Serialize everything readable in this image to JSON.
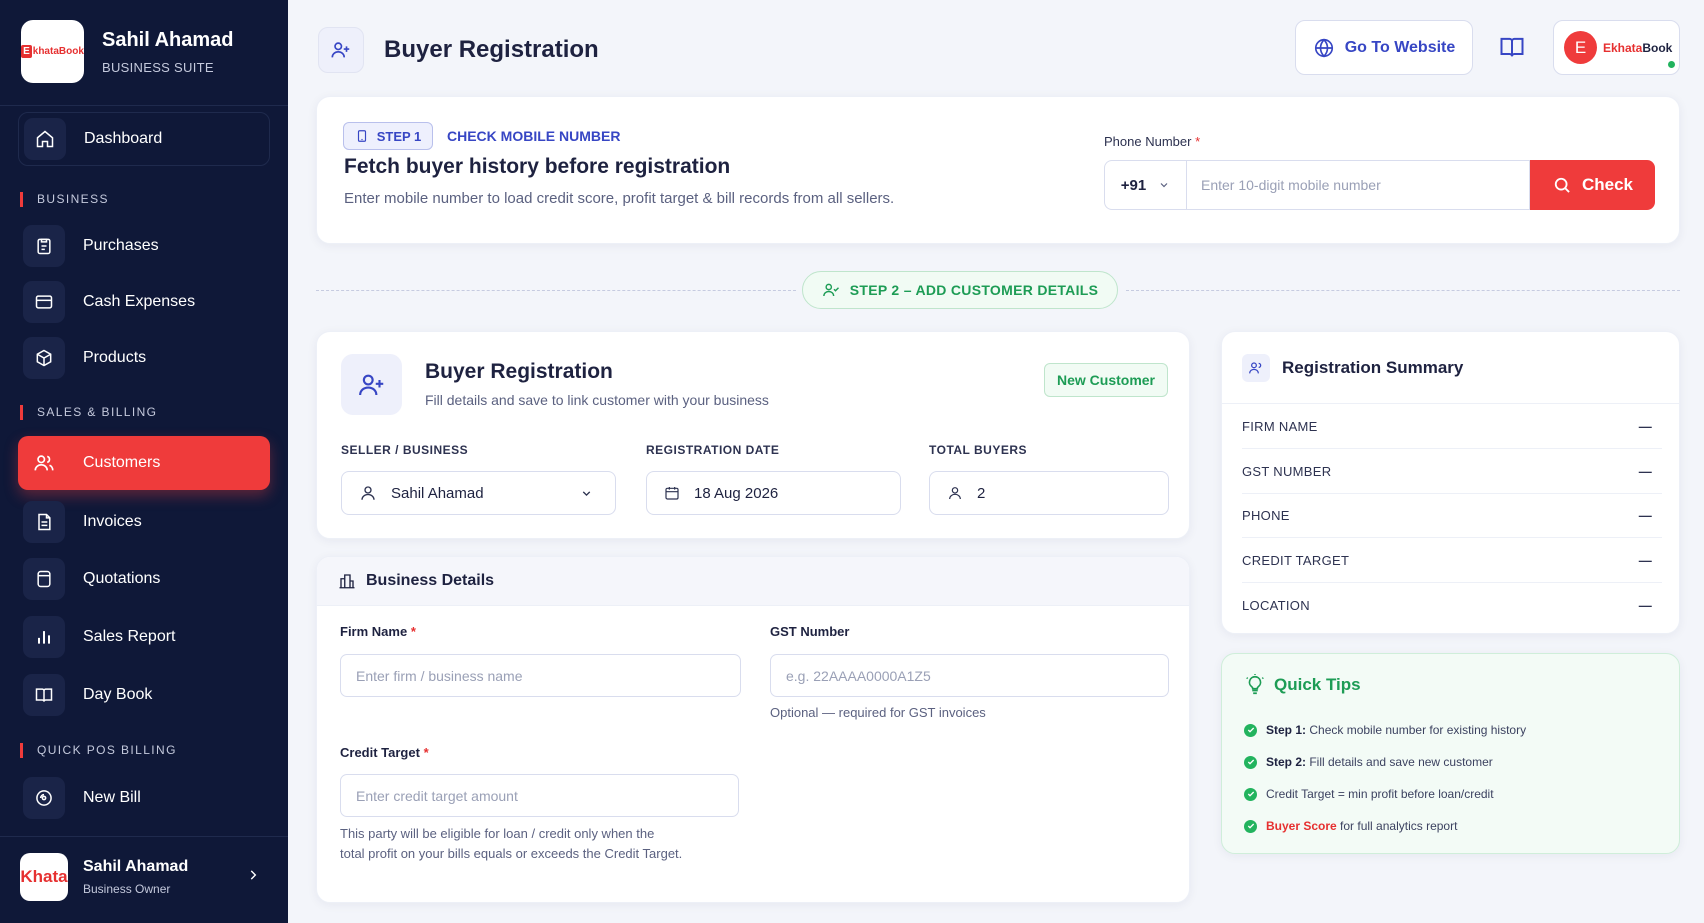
{
  "sidebar": {
    "brand_name": "Sahil Ahamad",
    "brand_sub": "BUSINESS SUITE",
    "logo_e": "E",
    "logo_text": "khataBook",
    "dashboard": "Dashboard",
    "section_business": "BUSINESS",
    "purchases": "Purchases",
    "cash_expenses": "Cash Expenses",
    "products": "Products",
    "section_sales": "SALES & BILLING",
    "customers": "Customers",
    "invoices": "Invoices",
    "quotations": "Quotations",
    "sales_report": "Sales Report",
    "day_book": "Day Book",
    "section_pos": "QUICK POS BILLING",
    "new_bill": "New Bill",
    "user_avatar_text": "Khata",
    "user_name": "Sahil Ahamad",
    "user_role": "Business Owner"
  },
  "header": {
    "title": "Buyer Registration",
    "website_button": "Go To Website",
    "account_initial": "E",
    "account_brand_a": "Ekhata",
    "account_brand_b": "Book"
  },
  "step1": {
    "badge": "STEP 1",
    "title": "CHECK MOBILE NUMBER",
    "heading": "Fetch buyer history before registration",
    "description": "Enter mobile number to load credit score, profit target & bill records from all sellers.",
    "phone_label": "Phone Number",
    "required_mark": "*",
    "country_code": "+91",
    "phone_placeholder": "Enter 10-digit mobile number",
    "check_button": "Check"
  },
  "step2": {
    "label": "STEP 2 – ADD CUSTOMER DETAILS"
  },
  "registration": {
    "title": "Buyer Registration",
    "subtitle": "Fill details and save to link customer with your business",
    "badge": "New Customer",
    "seller_label": "SELLER / BUSINESS",
    "seller_value": "Sahil Ahamad",
    "date_label": "REGISTRATION DATE",
    "date_value": "18 Aug 2026",
    "buyers_label": "TOTAL BUYERS",
    "buyers_value": "2"
  },
  "business": {
    "heading": "Business Details",
    "firm_label": "Firm Name",
    "firm_placeholder": "Enter firm / business name",
    "gst_label": "GST Number",
    "gst_placeholder": "e.g. 22AAAA0000A1Z5",
    "gst_hint": "Optional — required for GST invoices",
    "credit_label": "Credit Target",
    "credit_placeholder": "Enter credit target amount",
    "credit_hint_line1": "This party will be eligible for loan / credit only when the",
    "credit_hint_line2": "total profit on your bills equals or exceeds the Credit Target.",
    "required_mark": "*"
  },
  "summary": {
    "title": "Registration Summary",
    "rows": [
      {
        "label": "FIRM NAME",
        "value": "—"
      },
      {
        "label": "GST NUMBER",
        "value": "—"
      },
      {
        "label": "PHONE",
        "value": "—"
      },
      {
        "label": "CREDIT TARGET",
        "value": "—"
      },
      {
        "label": "LOCATION",
        "value": "—"
      }
    ]
  },
  "tips": {
    "title": "Quick Tips",
    "t1_bold": "Step 1:",
    "t1_text": " Check mobile number for existing history",
    "t2_bold": "Step 2:",
    "t2_text": " Fill details and save new customer",
    "t3_text": "Credit Target = min profit before loan/credit",
    "t4_red": "Buyer Score",
    "t4_text": " for full analytics report"
  },
  "colors": {
    "sidebar_bg": "#0f1838",
    "accent_red": "#ef3b3b",
    "accent_blue": "#3746c4",
    "accent_green": "#1d9c55"
  }
}
